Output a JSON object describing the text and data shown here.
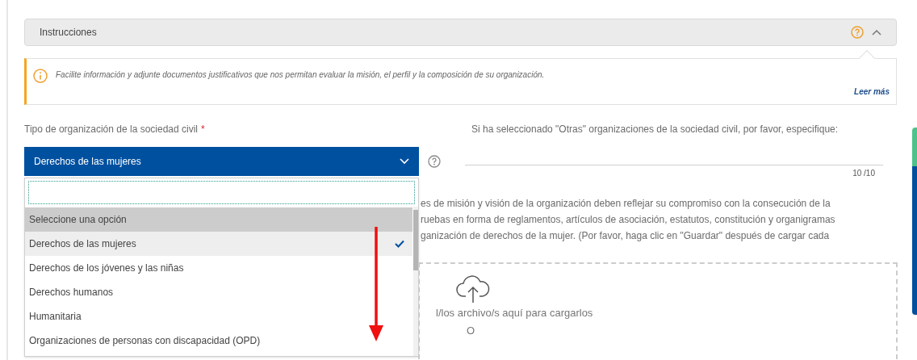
{
  "instructions": {
    "title": "Instrucciones",
    "expanded": true,
    "note": "Facilite información y adjunte documentos justificativos que nos permitan evaluar la misión, el perfil y la composición de su organización.",
    "link": "Leer más"
  },
  "org_type": {
    "label": "Tipo de organización de la sociedad civil",
    "required_mark": "*",
    "value": "Derechos de las mujeres",
    "open": true,
    "options": [
      {
        "label": "Seleccione una opción",
        "hovered": true,
        "selected": false
      },
      {
        "label": "Derechos de las mujeres",
        "hovered": false,
        "selected": true
      },
      {
        "label": "Derechos de los jóvenes y las niñas",
        "hovered": false,
        "selected": false
      },
      {
        "label": "Derechos humanos",
        "hovered": false,
        "selected": false
      },
      {
        "label": "Humanitaria",
        "hovered": false,
        "selected": false
      },
      {
        "label": "Organizaciones de personas con discapacidad (OPD)",
        "hovered": false,
        "selected": false
      }
    ]
  },
  "other": {
    "label": "Si ha seleccionado \"Otras\" organizaciones de la sociedad civil, por favor, especifique:",
    "counter": "10 /10"
  },
  "description_lines": [
    "es de misión y visión de la organización deben reflejar su compromiso con la consecución de la",
    "ruebas en forma de reglamentos, artículos de asociación, estatutos, constitución y organigramas",
    "ganización de derechos de la mujer. (Por favor, haga clic en \"Guardar\" después de cargar cada"
  ],
  "upload": {
    "hint": "l/los archivo/s aquí para cargarlos",
    "or": "O"
  }
}
